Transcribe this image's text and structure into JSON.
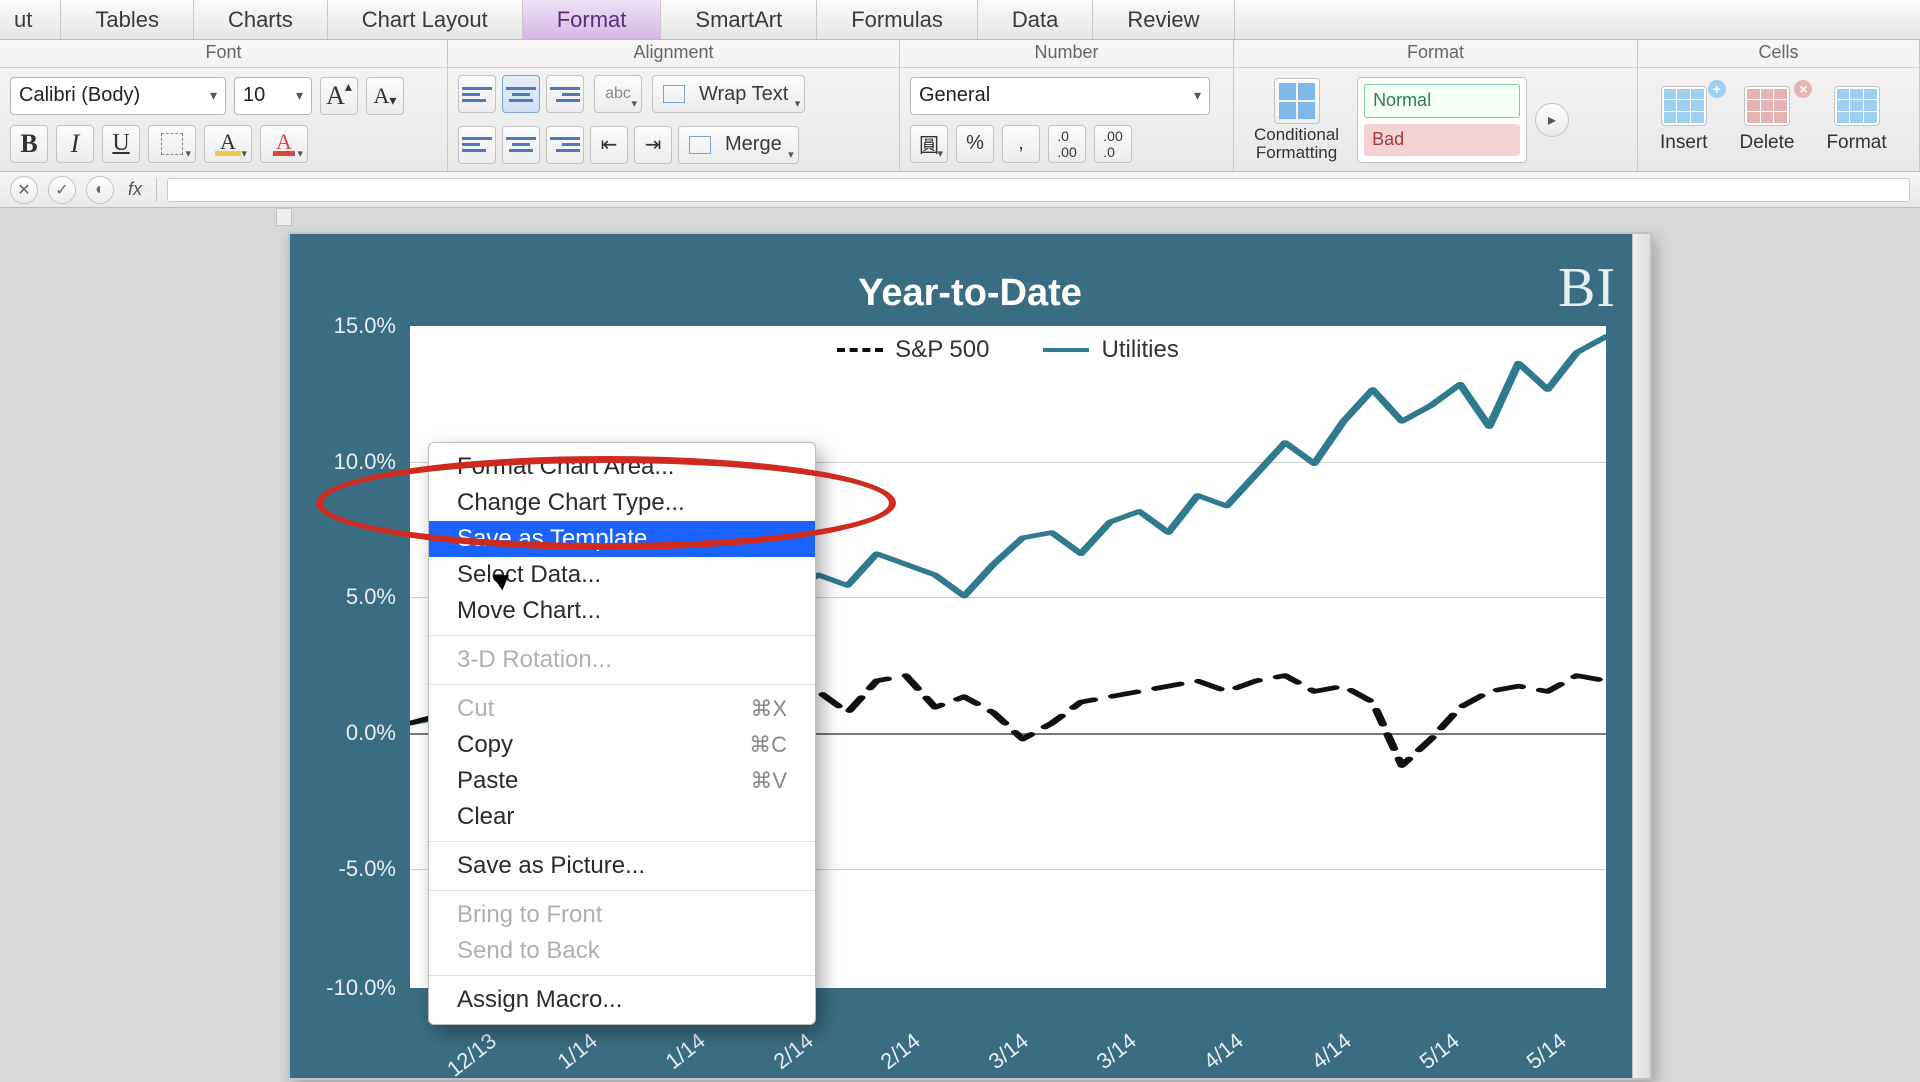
{
  "tabs": {
    "cut": "ut",
    "tables": "Tables",
    "charts": "Charts",
    "chart_layout": "Chart Layout",
    "format": "Format",
    "smartart": "SmartArt",
    "formulas": "Formulas",
    "data": "Data",
    "review": "Review",
    "active": "format"
  },
  "groups": {
    "font": {
      "title": "Font",
      "font_name": "Calibri (Body)",
      "font_size": "10",
      "grow_A": "A",
      "shrink_A": "A",
      "bold": "B",
      "italic": "I",
      "underline": "U",
      "fill_letter": "A",
      "font_color_letter": "A"
    },
    "alignment": {
      "title": "Alignment",
      "abc": "abc",
      "wrap": "Wrap Text",
      "merge": "Merge"
    },
    "number": {
      "title": "Number",
      "format": "General"
    },
    "format": {
      "title": "Format",
      "cond": "Conditional\nFormatting",
      "style_normal": "Normal",
      "style_bad": "Bad"
    },
    "cells": {
      "title": "Cells",
      "insert": "Insert",
      "delete": "Delete",
      "format": "Format"
    }
  },
  "formula_bar": {
    "fx": "fx"
  },
  "context_menu": {
    "items": [
      {
        "label": "Format Chart Area...",
        "disabled": false
      },
      {
        "label": "Change Chart Type...",
        "disabled": false
      },
      {
        "label": "Save as Template...",
        "disabled": false,
        "hovered": true
      },
      {
        "label": "Select Data...",
        "disabled": false
      },
      {
        "label": "Move Chart...",
        "disabled": false
      },
      {
        "sep": true
      },
      {
        "label": "3-D Rotation...",
        "disabled": true
      },
      {
        "sep": true
      },
      {
        "label": "Cut",
        "shortcut": "⌘X",
        "disabled": true
      },
      {
        "label": "Copy",
        "shortcut": "⌘C",
        "disabled": false
      },
      {
        "label": "Paste",
        "shortcut": "⌘V",
        "disabled": false
      },
      {
        "label": "Clear",
        "disabled": false
      },
      {
        "sep": true
      },
      {
        "label": "Save as Picture...",
        "disabled": false
      },
      {
        "sep": true
      },
      {
        "label": "Bring to Front",
        "disabled": true
      },
      {
        "label": "Send to Back",
        "disabled": true
      },
      {
        "sep": true
      },
      {
        "label": "Assign Macro...",
        "disabled": false
      }
    ]
  },
  "chart_data": {
    "type": "line",
    "title": "Year-to-Date",
    "brand": "BI",
    "ylabel": "",
    "xlabel": "",
    "ylim": [
      -10,
      15
    ],
    "y_ticks": [
      "15.0%",
      "10.0%",
      "5.0%",
      "0.0%",
      "-5.0%",
      "-10.0%"
    ],
    "x_ticks": [
      "12/13",
      "1/14",
      "1/14",
      "2/14",
      "2/14",
      "3/14",
      "3/14",
      "4/14",
      "4/14",
      "5/14",
      "5/14"
    ],
    "legend": [
      "S&P 500",
      "Utilities"
    ],
    "series": [
      {
        "name": "S&P 500",
        "style": "dashed-black",
        "values": [
          0.0,
          0.3,
          -1.0,
          -3.0,
          -2.2,
          -3.6,
          -0.8,
          -1.2,
          0.2,
          -0.4,
          0.4,
          0.6,
          1.4,
          1.8,
          1.2,
          0.4,
          1.6,
          1.8,
          0.6,
          1.0,
          0.4,
          -0.6,
          0.0,
          0.8,
          1.0,
          1.2,
          1.4,
          1.6,
          1.2,
          1.6,
          1.8,
          1.2,
          1.4,
          0.8,
          -1.6,
          -0.6,
          0.6,
          1.2,
          1.4,
          1.2,
          1.8,
          1.6
        ]
      },
      {
        "name": "Utilities",
        "style": "solid-teal",
        "values": [
          0.0,
          0.2,
          -0.8,
          -2.4,
          -1.8,
          -2.6,
          1.6,
          1.0,
          2.6,
          1.8,
          3.0,
          4.8,
          5.8,
          5.0,
          5.6,
          5.2,
          6.4,
          6.0,
          5.6,
          4.8,
          6.0,
          7.0,
          7.2,
          6.4,
          7.6,
          8.0,
          7.2,
          8.6,
          8.2,
          9.4,
          10.6,
          9.8,
          11.4,
          12.6,
          11.4,
          12.0,
          12.8,
          11.2,
          13.6,
          12.6,
          14.0,
          14.6
        ]
      }
    ]
  }
}
